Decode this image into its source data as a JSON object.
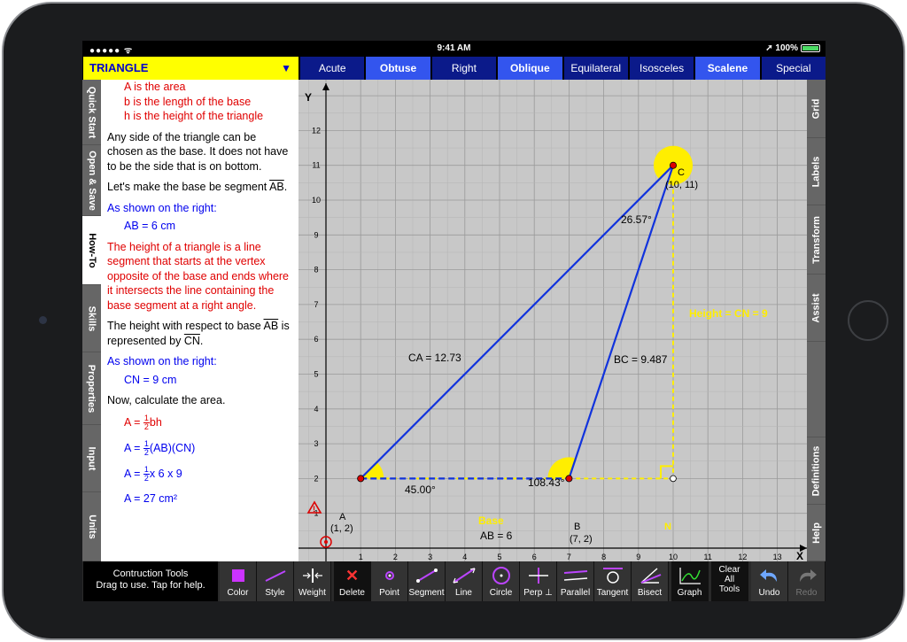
{
  "status": {
    "signal": "●●●●● ᯤ",
    "time": "9:41 AM",
    "battery": "➚ 100%"
  },
  "title": {
    "text": "TRIANGLE",
    "dropdown_icon": "triangle-down-icon"
  },
  "type_tabs": [
    {
      "label": "Acute",
      "active": false
    },
    {
      "label": "Obtuse",
      "active": true
    },
    {
      "label": "Right",
      "active": false
    },
    {
      "label": "Oblique",
      "active": true
    },
    {
      "label": "Equilateral",
      "active": false
    },
    {
      "label": "Isosceles",
      "active": false
    },
    {
      "label": "Scalene",
      "active": true
    },
    {
      "label": "Special",
      "active": false
    }
  ],
  "side_tabs": [
    "Quick Start",
    "Open & Save",
    "How-To",
    "Skills",
    "Properties",
    "Input",
    "Units"
  ],
  "right_tabs": [
    "Grid",
    "Labels",
    "Transform",
    "Assist",
    "",
    "Definitions",
    "Help"
  ],
  "content": {
    "defs": [
      "A is the area",
      "b is the length of the base",
      "h is the height of the triangle"
    ],
    "p1": "Any side of the triangle can be chosen as the base. It does not have to be the side that is on bottom.",
    "p2a": "Let's make the base be segment ",
    "p2b": "AB",
    "p2c": ".",
    "shown1": "As shown on the right:",
    "ab_eq": "AB = 6 cm",
    "p3": "The height of a triangle is a line segment that starts at the vertex opposite of the base and ends where it intersects the line containing the base segment at a right angle.",
    "p4a": "The height with respect to base ",
    "p4b": "AB",
    "p4c": " is represented by ",
    "p4d": "CN",
    "p4e": ".",
    "shown2": "As shown on the right:",
    "cn_eq": "CN = 9 cm",
    "p5": "Now, calculate the area.",
    "f1_pre": "A = ",
    "f1_n": "1",
    "f1_d": "2",
    "f1_post": "bh",
    "f2_pre": "A = ",
    "f2_n": "1",
    "f2_d": "2",
    "f2_post": "(AB)(CN)",
    "f3_pre": "A = ",
    "f3_n": "1",
    "f3_d": "2",
    "f3_post": "x 6 x 9",
    "f4": "A = 27 cm²"
  },
  "graph": {
    "y_axis_label": "Y",
    "x_axis_label": "X",
    "xlim": [
      0,
      14
    ],
    "ylim": [
      -0.5,
      13
    ],
    "x_ticks": [
      1,
      2,
      3,
      4,
      5,
      6,
      7,
      8,
      9,
      10,
      11,
      12,
      13
    ],
    "y_ticks": [
      1,
      2,
      3,
      4,
      5,
      6,
      7,
      8,
      9,
      10,
      11,
      12
    ],
    "points": [
      {
        "name": "A",
        "coord": "(1, 2)",
        "x": 1,
        "y": 2
      },
      {
        "name": "B",
        "coord": "(7, 2)",
        "x": 7,
        "y": 2
      },
      {
        "name": "C",
        "coord": "(10, 11)",
        "x": 10,
        "y": 11
      },
      {
        "name": "N",
        "coord": "",
        "x": 10,
        "y": 2
      }
    ],
    "side_labels": {
      "ca": "CA = 12.73",
      "bc": "BC = 9.487",
      "ab": "AB = 6",
      "base": "Base",
      "height": "Height = CN = 9"
    },
    "angles": {
      "a": "45.00°",
      "b": "108.43°",
      "c": "26.57°"
    },
    "colors": {
      "triangle": "#1133dd",
      "height": "#ffee00",
      "grid_bg": "#c8c8c8",
      "point": "#dd0000"
    }
  },
  "toolbar": {
    "info": "Contruction Tools\nDrag to use. Tap for help.",
    "info_line1": "Contruction Tools",
    "info_line2": "Drag to use. Tap for help.",
    "tools": [
      "Color",
      "Style",
      "Weight",
      "Delete",
      "Point",
      "Segment",
      "Line",
      "Circle",
      "Perp ⊥",
      "Parallel",
      "Tangent",
      "Bisect",
      "Graph",
      "Clear All Tools",
      "Undo",
      "Redo"
    ]
  }
}
